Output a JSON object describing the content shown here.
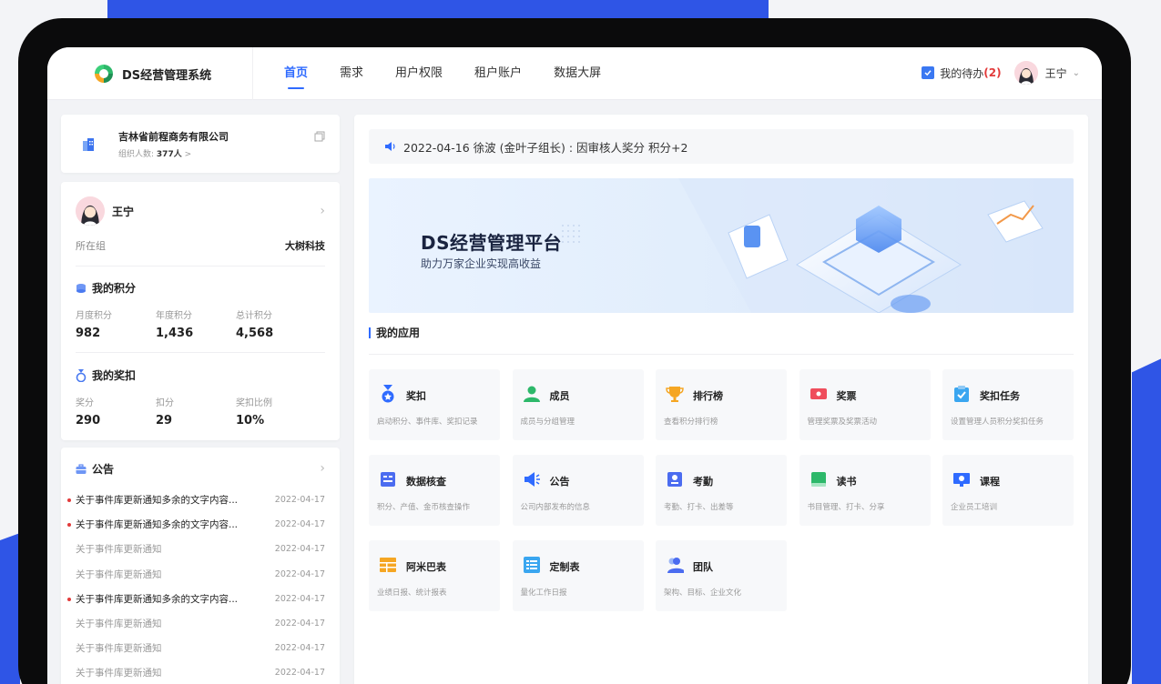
{
  "header": {
    "brand": "DS经营管理系统",
    "nav": [
      "首页",
      "需求",
      "用户权限",
      "租户账户",
      "数据大屏"
    ],
    "todo_label": "我的待办",
    "todo_count": "(2)",
    "user_name": "王宁"
  },
  "company": {
    "name": "吉林省前程商务有限公司",
    "member_label": "组织人数:",
    "member_count": "377人",
    "member_arrow": ">"
  },
  "profile": {
    "name": "王宁",
    "group_label": "所在组",
    "group_value": "大树科技",
    "points_title": "我的积分",
    "points": [
      {
        "label": "月度积分",
        "value": "982"
      },
      {
        "label": "年度积分",
        "value": "1,436"
      },
      {
        "label": "总计积分",
        "value": "4,568"
      }
    ],
    "rewards_title": "我的奖扣",
    "rewards": [
      {
        "label": "奖分",
        "value": "290"
      },
      {
        "label": "扣分",
        "value": "29"
      },
      {
        "label": "奖扣比例",
        "value": "10%"
      }
    ]
  },
  "notices": {
    "title": "公告",
    "items": [
      {
        "title": "关于事件库更新通知多余的文字内容...",
        "date": "2022-04-17",
        "unread": true
      },
      {
        "title": "关于事件库更新通知多余的文字内容...",
        "date": "2022-04-17",
        "unread": true
      },
      {
        "title": "关于事件库更新通知",
        "date": "2022-04-17",
        "unread": false
      },
      {
        "title": "关于事件库更新通知",
        "date": "2022-04-17",
        "unread": false
      },
      {
        "title": "关于事件库更新通知多余的文字内容...",
        "date": "2022-04-17",
        "unread": true
      },
      {
        "title": "关于事件库更新通知",
        "date": "2022-04-17",
        "unread": false
      },
      {
        "title": "关于事件库更新通知",
        "date": "2022-04-17",
        "unread": false
      },
      {
        "title": "关于事件库更新通知",
        "date": "2022-04-17",
        "unread": false
      }
    ]
  },
  "main": {
    "announcement": "2022-04-16 徐波 (金叶子组长) : 因审核人奖分 积分+2",
    "banner_title": "DS经营管理平台",
    "banner_subtitle": "助力万家企业实现高收益",
    "apps_title": "我的应用",
    "apps": [
      {
        "name": "奖扣",
        "desc": "启动积分、事件库、奖扣记录",
        "icon": "medal-icon",
        "color": "#2f6bff"
      },
      {
        "name": "成员",
        "desc": "成员与分组管理",
        "icon": "member-icon",
        "color": "#2db86a"
      },
      {
        "name": "排行榜",
        "desc": "查看积分排行榜",
        "icon": "trophy-icon",
        "color": "#f5a623"
      },
      {
        "name": "奖票",
        "desc": "管理奖票及奖票活动",
        "icon": "ticket-icon",
        "color": "#ef4d5c"
      },
      {
        "name": "奖扣任务",
        "desc": "设置管理人员积分奖扣任务",
        "icon": "task-check-icon",
        "color": "#3aa6f0"
      },
      {
        "name": "数据核查",
        "desc": "积分、产值、金币核查操作",
        "icon": "data-check-icon",
        "color": "#4b6cf0"
      },
      {
        "name": "公告",
        "desc": "公司内部发布的信息",
        "icon": "megaphone-icon",
        "color": "#2f6bff"
      },
      {
        "name": "考勤",
        "desc": "考勤、打卡、出差等",
        "icon": "attendance-icon",
        "color": "#4b6cf0"
      },
      {
        "name": "读书",
        "desc": "书目管理、打卡、分享",
        "icon": "book-icon",
        "color": "#2db86a"
      },
      {
        "name": "课程",
        "desc": "企业员工培训",
        "icon": "course-icon",
        "color": "#2f6bff"
      },
      {
        "name": "阿米巴表",
        "desc": "业绩日报、统计报表",
        "icon": "table-icon",
        "color": "#f5a623"
      },
      {
        "name": "定制表",
        "desc": "量化工作日报",
        "icon": "custom-table-icon",
        "color": "#3aa6f0"
      },
      {
        "name": "团队",
        "desc": "架构、目标、企业文化",
        "icon": "team-icon",
        "color": "#4b6cf0"
      }
    ]
  }
}
